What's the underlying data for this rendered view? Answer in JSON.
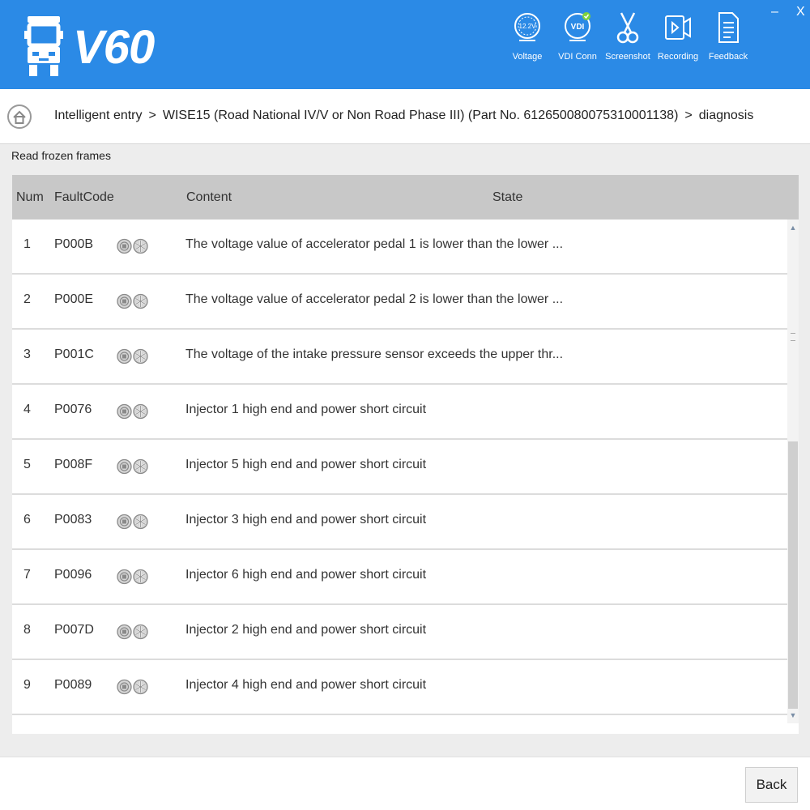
{
  "app": {
    "brand": "V60",
    "logo_icon": "truck-icon",
    "accent_color": "#2b8ae6"
  },
  "toolbar": {
    "items": [
      {
        "label": "Voltage",
        "icon": "voltage-gauge-icon",
        "badge": "12.2V"
      },
      {
        "label": "VDI Conn",
        "icon": "vdi-connection-icon",
        "badge": "VDI"
      },
      {
        "label": "Screenshot",
        "icon": "scissors-icon"
      },
      {
        "label": "Recording",
        "icon": "video-camera-icon"
      },
      {
        "label": "Feedback",
        "icon": "document-icon"
      }
    ],
    "minimize_label": "–",
    "close_label": "X"
  },
  "breadcrumb": {
    "home_icon": "home-icon",
    "separator": ">",
    "items": [
      "Intelligent entry",
      "WISE15 (Road National IV/V or Non Road Phase III) (Part No. 612650080075310001138)",
      "diagnosis"
    ]
  },
  "section_title": "Read frozen frames",
  "table": {
    "columns": [
      "Num",
      "FaultCode",
      "Content",
      "State"
    ],
    "row_icons": [
      "frozen-frame-icon",
      "snowflake-icon"
    ],
    "rows": [
      {
        "num": "1",
        "code": "P000B",
        "content": "The voltage value of accelerator pedal 1 is lower than the lower ...",
        "state": ""
      },
      {
        "num": "2",
        "code": "P000E",
        "content": "The voltage value of accelerator pedal 2 is lower than the lower ...",
        "state": ""
      },
      {
        "num": "3",
        "code": "P001C",
        "content": "The voltage of the intake pressure sensor exceeds the upper thr...",
        "state": ""
      },
      {
        "num": "4",
        "code": "P0076",
        "content": "Injector 1 high end and power short circuit",
        "state": ""
      },
      {
        "num": "5",
        "code": "P008F",
        "content": "Injector 5 high end and power short circuit",
        "state": ""
      },
      {
        "num": "6",
        "code": "P0083",
        "content": "Injector 3 high end and power short circuit",
        "state": ""
      },
      {
        "num": "7",
        "code": "P0096",
        "content": "Injector 6 high end and power short circuit",
        "state": ""
      },
      {
        "num": "8",
        "code": "P007D",
        "content": "Injector 2 high end and power short circuit",
        "state": ""
      },
      {
        "num": "9",
        "code": "P0089",
        "content": "Injector 4 high end and power short circuit",
        "state": ""
      }
    ]
  },
  "footer": {
    "back_label": "Back"
  }
}
